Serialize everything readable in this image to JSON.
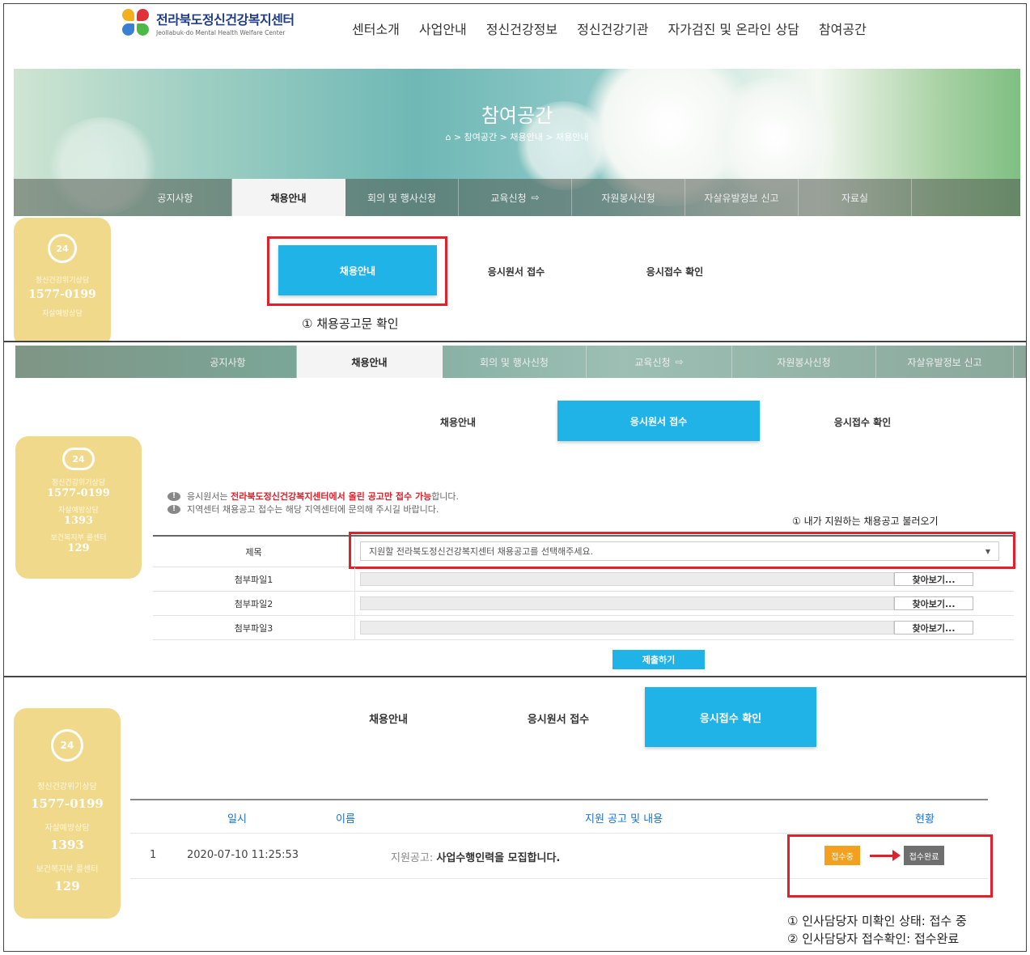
{
  "header": {
    "logo_title": "전라북도정신건강복지센터",
    "logo_sub": "Jeollabuk-do Mental Health Welfare Center",
    "menu": [
      "센터소개",
      "사업안내",
      "정신건강정보",
      "정신건강기관",
      "자가검진 및 온라인 상담",
      "참여공간"
    ]
  },
  "banner": {
    "title": "참여공간",
    "breadcrumb": "> 참여공간 > 채용안내 > 채용안내"
  },
  "subnav": [
    "공지사항",
    "채용안내",
    "회의 및 행사신청",
    "교육신청",
    "자원봉사신청",
    "자살유발정보 신고",
    "자료실"
  ],
  "subnav2": [
    "공지사항",
    "채용안내",
    "회의 및 행사신청",
    "교육신청",
    "자원봉사신청",
    "자살유발정보 신고"
  ],
  "side": {
    "badge": "24",
    "l1": "정신건강위기상담",
    "n1": "1577-0199",
    "l2": "자살예방상담",
    "n2": "1393",
    "l3": "보건복지부 콜센터",
    "n3": "129"
  },
  "tabs": [
    "채용안내",
    "응시원서 접수",
    "응시접수 확인"
  ],
  "notes": {
    "p1": "① 채용공고문 확인",
    "p2": "① 내가 지원하는 채용공고 불러오기",
    "p3a": "① 인사담당자 미확인 상태: 접수 중",
    "p3b": "② 인사담당자 접수확인: 접수완료"
  },
  "form": {
    "info1_pre": "응시원서는 ",
    "info1_hl": "전라북도정신건강복지센터에서 올린 공고만 접수 가능",
    "info1_post": "합니다.",
    "info2": "지역센터 채용공고 접수는 해당 지역센터에 문의해 주시길 바랍니다.",
    "title_label": "제목",
    "select_placeholder": "지원할 전라북도정신건강복지센터 채용공고를 선택해주세요.",
    "files": [
      "첨부파일1",
      "첨부파일2",
      "첨부파일3"
    ],
    "find_label": "찾아보기...",
    "submit_label": "제출하기"
  },
  "table": {
    "headers": [
      "일시",
      "이름",
      "지원 공고 및 내용",
      "현황"
    ],
    "row": {
      "no": "1",
      "date": "2020-07-10 11:25:53",
      "content_prefix": "지원공고: ",
      "content": "사업수행인력을 모집합니다.",
      "status_pending": "접수중",
      "status_done": "접수완료"
    }
  },
  "colors": {
    "accent": "#1fb3e8",
    "side": "#f1d98c",
    "highlight": "#e0202a",
    "pending": "#f2a01e",
    "done": "#6f6f6f"
  }
}
